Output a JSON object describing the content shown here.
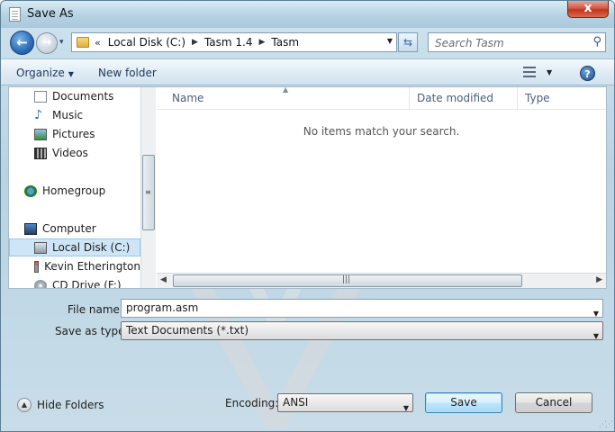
{
  "window": {
    "title": "Save As",
    "close_label": "x"
  },
  "nav": {
    "back_glyph": "←",
    "forward_glyph": "→",
    "history_glyph": "▾",
    "breadcrumb": [
      "Local Disk (C:)",
      "Tasm 1.4",
      "Tasm"
    ],
    "breadcrumb_lead": "«",
    "search_placeholder": "Search Tasm"
  },
  "command_bar": {
    "organize_label": "Organize",
    "new_folder_label": "New folder",
    "help_glyph": "?"
  },
  "sidebar": {
    "items": [
      {
        "label": "Documents",
        "icon": "documents-icon"
      },
      {
        "label": "Music",
        "icon": "music-icon"
      },
      {
        "label": "Pictures",
        "icon": "pictures-icon"
      },
      {
        "label": "Videos",
        "icon": "videos-icon"
      },
      {
        "label": "Homegroup",
        "icon": "homegroup-icon"
      },
      {
        "label": "Computer",
        "icon": "computer-icon"
      },
      {
        "label": "Local Disk (C:)",
        "icon": "local-disk-icon",
        "selected": true
      },
      {
        "label": "Kevin Etherington",
        "icon": "network-drive-icon"
      },
      {
        "label": "CD Drive (F:)",
        "icon": "cd-drive-icon"
      }
    ]
  },
  "file_list": {
    "columns": [
      "Name",
      "Date modified",
      "Type"
    ],
    "empty_message": "No items match your search."
  },
  "form": {
    "file_name_label": "File name:",
    "file_name_value": "program.asm",
    "save_type_label": "Save as type:",
    "save_type_value": "Text Documents (*.txt)",
    "encoding_label": "Encoding:",
    "encoding_value": "ANSI"
  },
  "footer": {
    "hide_folders_label": "Hide Folders",
    "save_label": "Save",
    "cancel_label": "Cancel"
  },
  "colors": {
    "accent": "#3c7fb1",
    "close": "#c3331b",
    "selection": "#cde5f7"
  }
}
